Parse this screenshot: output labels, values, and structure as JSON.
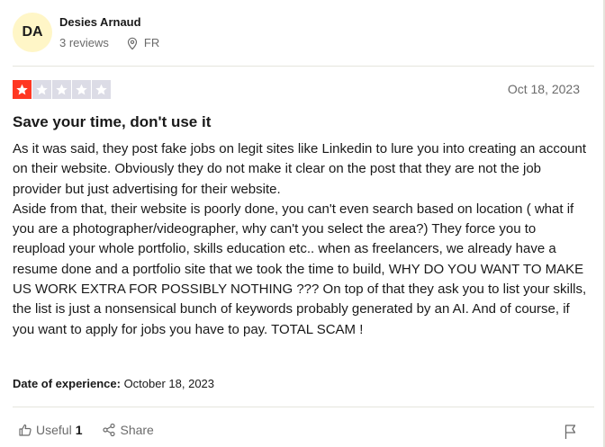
{
  "reviewer": {
    "initials": "DA",
    "name": "Desies Arnaud",
    "reviews_count": "3 reviews",
    "country": "FR"
  },
  "review": {
    "rating": 1,
    "max_rating": 5,
    "date": "Oct 18, 2023",
    "title": "Save your time, don't use it",
    "paragraphs": [
      "As it was said, they post fake jobs on legit sites like Linkedin to lure you into creating an account on their website. Obviously they do not make it clear on the post that they are not the job provider but just advertising for their website.",
      "Aside from that, their website is poorly done, you can't even search based on location ( what if you are a photographer/videographer, why can't you select the area?) They force you to reupload your whole portfolio, skills education etc.. when as freelancers, we already have a resume done and a portfolio site that we took the time to build, WHY DO YOU WANT TO MAKE US WORK EXTRA FOR POSSIBLY NOTHING ??? On top of that they ask you to list your skills, the list is just a nonsensical bunch of keywords probably generated by an AI. And of course, if you want to apply for jobs you have to pay. TOTAL SCAM !"
    ],
    "experience_label": "Date of experience:",
    "experience_date": "October 18, 2023"
  },
  "actions": {
    "useful_label": "Useful",
    "useful_count": "1",
    "share_label": "Share"
  },
  "colors": {
    "star_filled": "#ff3722",
    "star_empty": "#dcdce6",
    "avatar_bg": "#fff6c7"
  },
  "icons": [
    "location-pin-icon",
    "star-icon",
    "thumbs-up-icon",
    "share-icon",
    "flag-icon"
  ]
}
